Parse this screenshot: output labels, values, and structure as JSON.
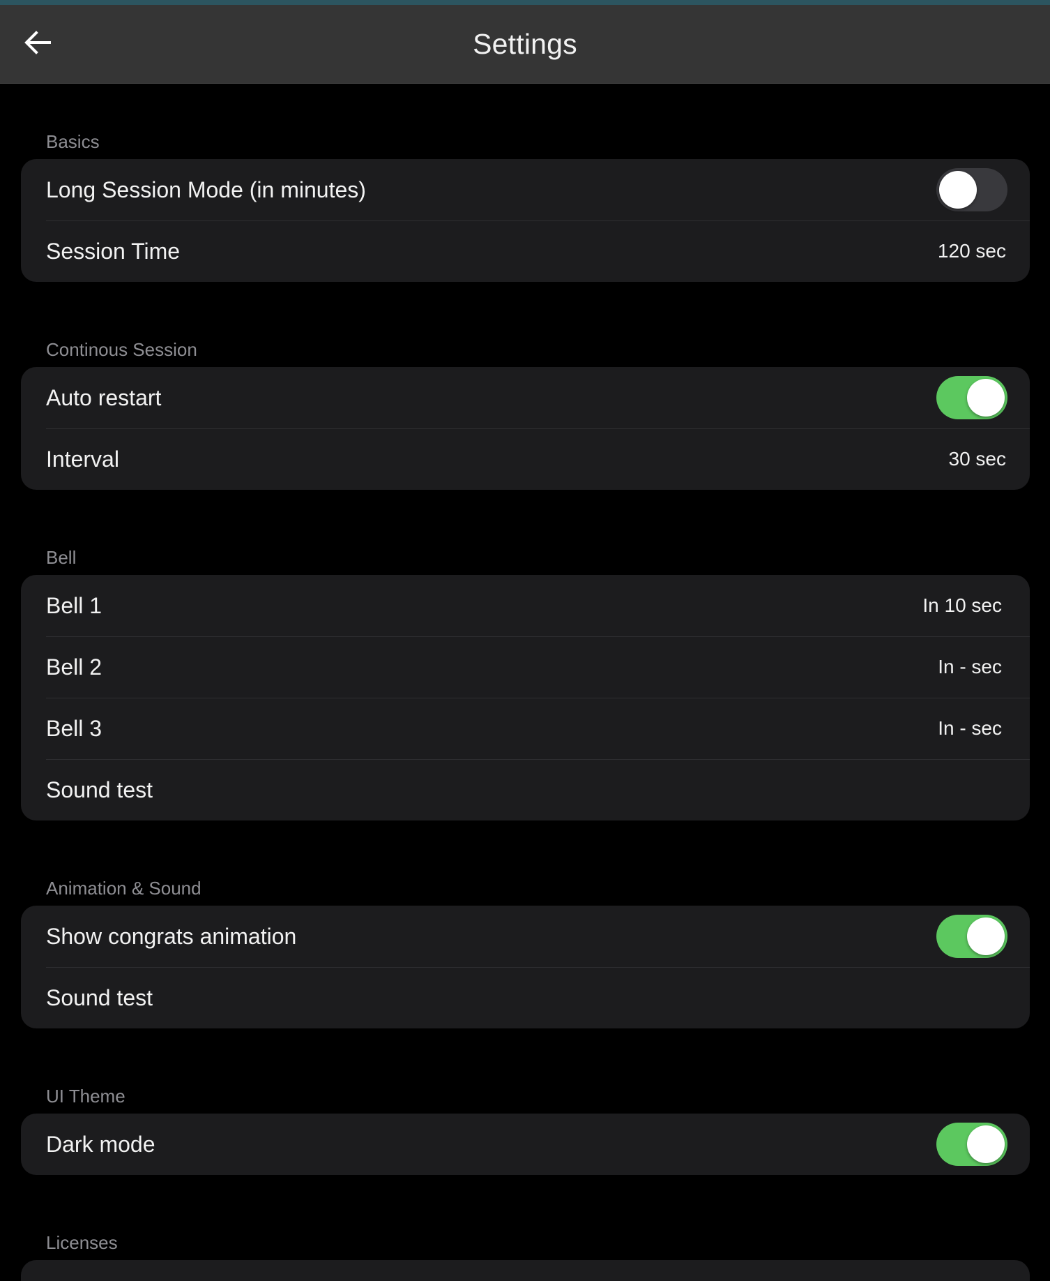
{
  "header": {
    "title": "Settings",
    "back_icon": "arrow-left-icon"
  },
  "colors": {
    "background": "#000000",
    "appbar": "#353535",
    "card": "#1c1c1e",
    "section_label": "#8e8e93",
    "switch_on": "#5cc85f",
    "switch_off": "#39393d"
  },
  "sections": {
    "basics": {
      "label": "Basics",
      "long_session": {
        "label": "Long Session Mode (in minutes)",
        "enabled": false
      },
      "session_time": {
        "label": "Session Time",
        "value": "120 sec"
      }
    },
    "continuous": {
      "label": "Continous Session",
      "auto_restart": {
        "label": "Auto restart",
        "enabled": true
      },
      "interval": {
        "label": "Interval",
        "value": "30 sec"
      }
    },
    "bell": {
      "label": "Bell",
      "bell1": {
        "label": "Bell 1",
        "value": "In 10 sec"
      },
      "bell2": {
        "label": "Bell 2",
        "value": "In - sec"
      },
      "bell3": {
        "label": "Bell 3",
        "value": "In - sec"
      },
      "sound_test": {
        "label": "Sound test"
      }
    },
    "animation_sound": {
      "label": "Animation & Sound",
      "congrats": {
        "label": "Show congrats animation",
        "enabled": true
      },
      "sound_test": {
        "label": "Sound test"
      }
    },
    "ui_theme": {
      "label": "UI Theme",
      "dark_mode": {
        "label": "Dark mode",
        "enabled": true
      }
    },
    "licenses": {
      "label": "Licenses"
    }
  }
}
